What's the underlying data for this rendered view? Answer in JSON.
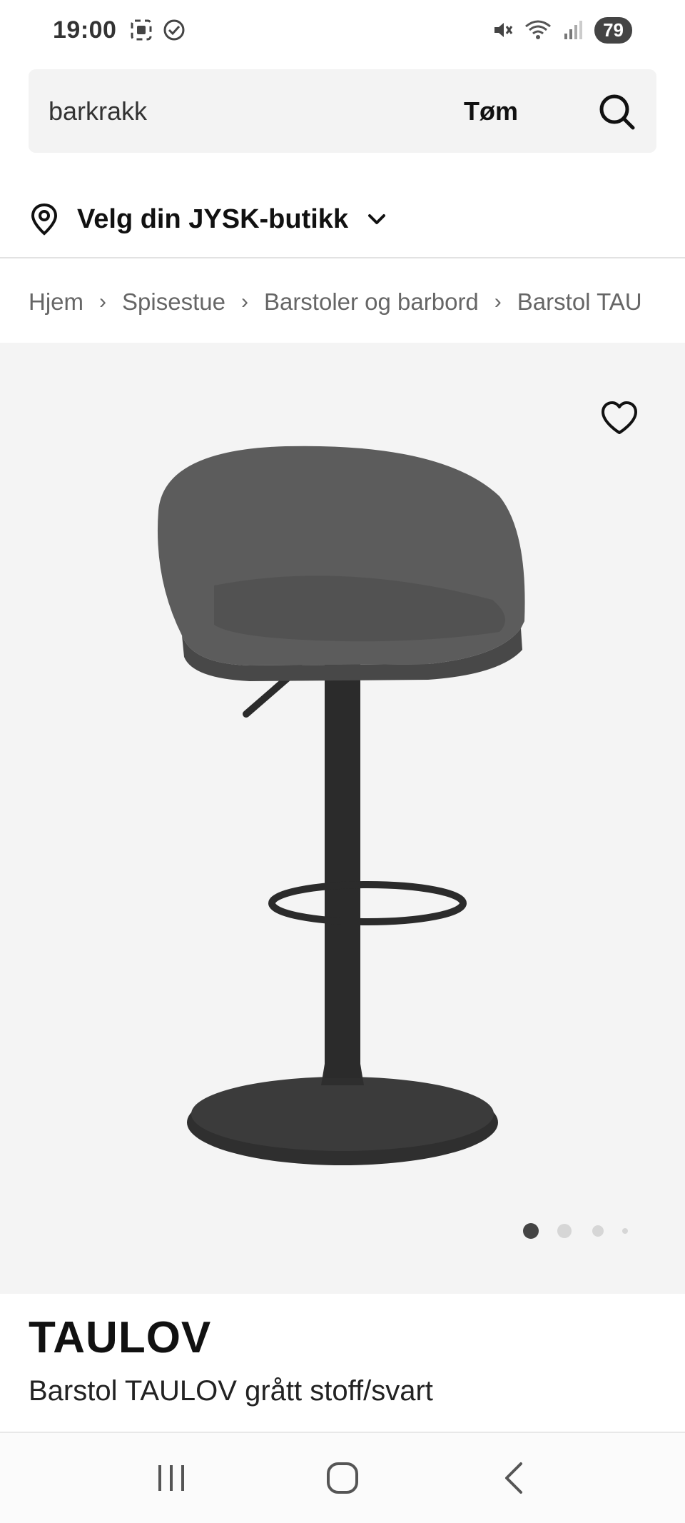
{
  "status_bar": {
    "time": "19:00",
    "battery": "79",
    "icons": [
      "screenshot-icon",
      "check-circle-icon",
      "mute-icon",
      "wifi-icon",
      "signal-icon"
    ]
  },
  "search": {
    "value": "barkrakk",
    "clear_label": "Tøm",
    "icon": "search-icon"
  },
  "store": {
    "label": "Velg din JYSK-butikk",
    "icon": "location-pin-icon"
  },
  "breadcrumb": {
    "items": [
      "Hjem",
      "Spisestue",
      "Barstoler og barbord",
      "Barstol TAU"
    ]
  },
  "product": {
    "brand": "TAULOV",
    "name": "Barstol TAULOV grått stoff/svart",
    "image_count": 4,
    "active_image": 1
  },
  "colors": {
    "accent": "#111111",
    "image_bg": "#f4f4f4",
    "text_muted": "#666666"
  },
  "nav": {
    "items": [
      "recent-apps-icon",
      "home-icon",
      "back-icon"
    ]
  }
}
